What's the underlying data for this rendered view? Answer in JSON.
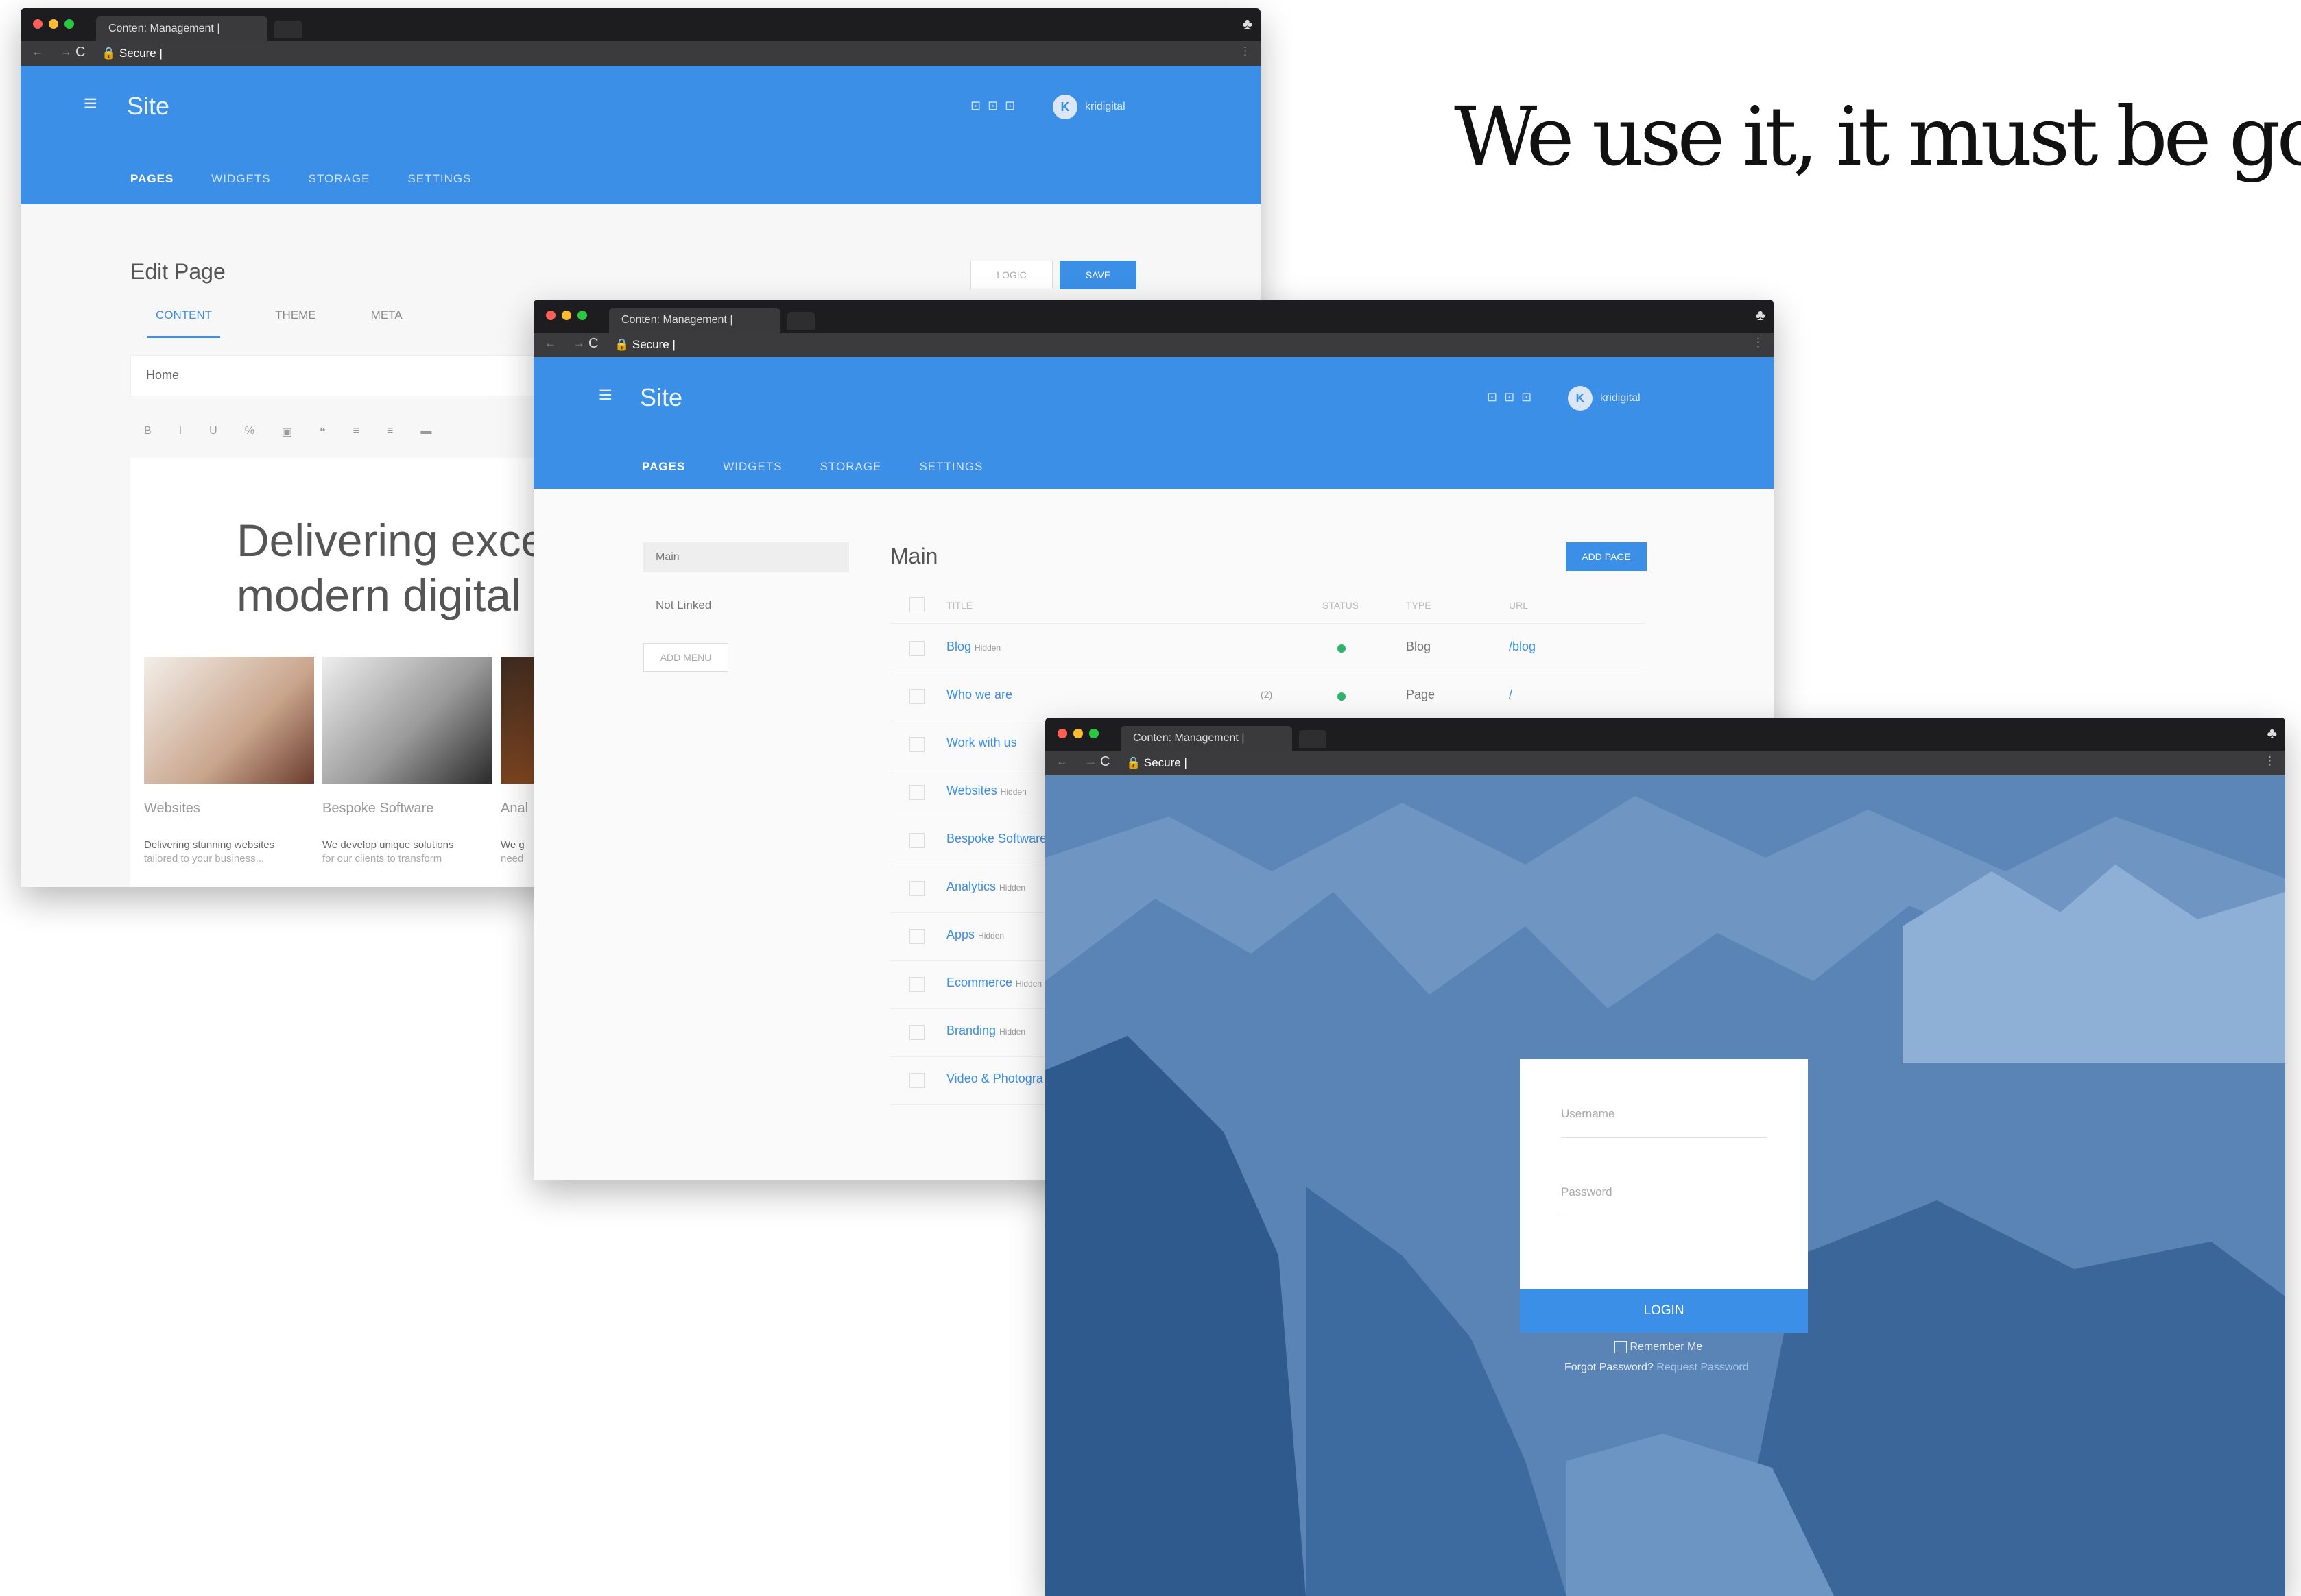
{
  "headline": "We use it, it must be good",
  "browser": {
    "tab_title": "Conten: Management |",
    "secure_label": "Secure |",
    "reload_glyph": "C",
    "nav_glyph": "← →",
    "incognito_glyph": "♣",
    "menu_glyph": "⋮"
  },
  "app": {
    "site_title": "Site",
    "username": "kridigital",
    "avatar_initial": "K",
    "nav": [
      "PAGES",
      "WIDGETS",
      "STORAGE",
      "SETTINGS"
    ]
  },
  "editor": {
    "page_title": "Edit Page",
    "logic_button": "LOGIC",
    "save_button": "SAVE",
    "tabs": [
      "CONTENT",
      "THEME",
      "META"
    ],
    "name_value": "Home",
    "toolbar_glyphs": [
      "B",
      "I",
      "U",
      "%",
      "▣",
      "❝",
      "≡",
      "≡",
      "▬"
    ],
    "hero_line1": "Delivering exce",
    "hero_line2": "modern digital",
    "cards": [
      {
        "title": "Websites",
        "text1": "Delivering stunning websites",
        "text2": "tailored to your business..."
      },
      {
        "title": "Bespoke Software",
        "text1": "We develop unique solutions",
        "text2": "for our clients to transform"
      },
      {
        "title": "Anal",
        "text1": "We g",
        "text2": "need"
      }
    ]
  },
  "pages": {
    "sidebar": [
      "Main",
      "Not Linked"
    ],
    "add_menu_button": "ADD MENU",
    "heading": "Main",
    "add_page_button": "ADD PAGE",
    "columns": [
      "TITLE",
      "STATUS",
      "TYPE",
      "URL"
    ],
    "rows": [
      {
        "title": "Blog",
        "tag": "Hidden",
        "extra": "",
        "status": "green",
        "type": "Blog",
        "url": "/blog"
      },
      {
        "title": "Who we are",
        "tag": "",
        "extra": "(2)",
        "status": "green",
        "type": "Page",
        "url": "/"
      },
      {
        "title": "Work with us",
        "tag": "",
        "extra": "",
        "status": "",
        "type": "",
        "url": ""
      },
      {
        "title": "Websites",
        "tag": "Hidden",
        "extra": "",
        "status": "",
        "type": "",
        "url": ""
      },
      {
        "title": "Bespoke Software",
        "tag": "",
        "extra": "",
        "status": "",
        "type": "",
        "url": ""
      },
      {
        "title": "Analytics",
        "tag": "Hidden",
        "extra": "",
        "status": "",
        "type": "",
        "url": ""
      },
      {
        "title": "Apps",
        "tag": "Hidden",
        "extra": "",
        "status": "",
        "type": "",
        "url": ""
      },
      {
        "title": "Ecommerce",
        "tag": "Hidden",
        "extra": "",
        "status": "",
        "type": "",
        "url": ""
      },
      {
        "title": "Branding",
        "tag": "Hidden",
        "extra": "",
        "status": "",
        "type": "",
        "url": ""
      },
      {
        "title": "Video & Photogra",
        "tag": "",
        "extra": "",
        "status": "",
        "type": "",
        "url": ""
      }
    ]
  },
  "login": {
    "username_placeholder": "Username",
    "password_placeholder": "Password",
    "login_button": "LOGIN",
    "remember_me": "Remember Me",
    "forgot_text": "Forgot Password?",
    "reset_link": "Request Password"
  },
  "colors": {
    "accent": "#3b8fe6",
    "status_green": "#2fb56b",
    "light_red": "#ff5f57",
    "light_yellow": "#febc2e",
    "light_green": "#28c840"
  }
}
